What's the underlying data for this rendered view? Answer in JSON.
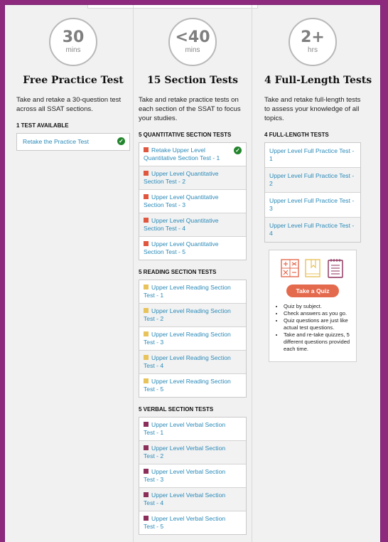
{
  "free": {
    "circle_num": "30",
    "circle_unit": "mins",
    "heading": "Free Practice Test",
    "desc": "Take and retake a 30-question test across all SSAT sections.",
    "label": "1 TEST AVAILABLE",
    "items": [
      "Retake the Practice Test"
    ]
  },
  "section": {
    "circle_num": "<40",
    "circle_unit": "mins",
    "heading": "15 Section Tests",
    "desc": "Take and retake practice tests on each section of the SSAT to focus your studies.",
    "quant_label": "5 QUANTITATIVE SECTION TESTS",
    "quant_items": [
      "Retake Upper Level Quantitative Section Test - 1",
      "Upper Level Quantitative Section Test - 2",
      "Upper Level Quantitative Section Test - 3",
      "Upper Level Quantitative Section Test - 4",
      "Upper Level Quantitative Section Test - 5"
    ],
    "reading_label": "5 READING SECTION TESTS",
    "reading_items": [
      "Upper Level Reading Section Test - 1",
      "Upper Level Reading Section Test - 2",
      "Upper Level Reading Section Test - 3",
      "Upper Level Reading Section Test - 4",
      "Upper Level Reading Section Test - 5"
    ],
    "verbal_label": "5 VERBAL SECTION TESTS",
    "verbal_items": [
      "Upper Level Verbal Section Test - 1",
      "Upper Level Verbal Section Test - 2",
      "Upper Level Verbal Section Test - 3",
      "Upper Level Verbal Section Test - 4",
      "Upper Level Verbal Section Test - 5"
    ]
  },
  "full": {
    "circle_num": "2+",
    "circle_unit": "hrs",
    "heading": "4 Full-Length Tests",
    "desc": "Take and retake full-length tests to assess your knowledge of all topics.",
    "label": "4 FULL-LENGTH TESTS",
    "items": [
      "Upper Level Full Practice Test - 1",
      "Upper Level Full Practice Test - 2",
      "Upper Level Full Practice Test - 3",
      "Upper Level Full Practice Test - 4"
    ]
  },
  "quiz": {
    "button": "Take a Quiz",
    "bullets": [
      "Quiz by subject.",
      "Check answers as you go.",
      "Quiz questions are just like actual test questions.",
      "Take and re-take quizzes, 5 different questions provided each time."
    ]
  },
  "colors": {
    "quant": "#e0573f",
    "reading": "#e8c25a",
    "verbal": "#8b2f5a",
    "link": "#2a8ab8",
    "check": "#22852c",
    "quiz_button": "#e46a4e"
  }
}
